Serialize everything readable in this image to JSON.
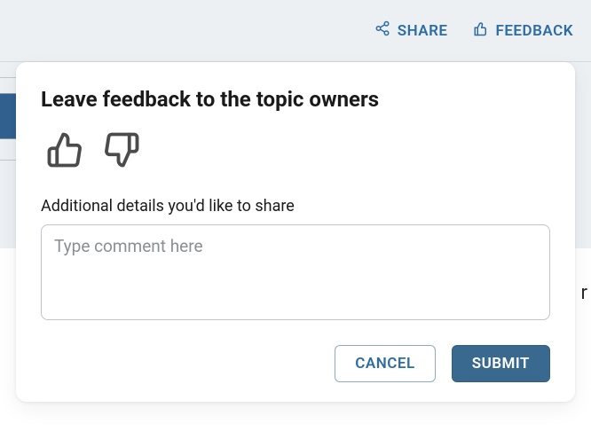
{
  "topbar": {
    "share_label": "SHARE",
    "feedback_label": "FEEDBACK"
  },
  "modal": {
    "title": "Leave feedback to the topic owners",
    "details_label": "Additional details you'd like to share",
    "comment_placeholder": "Type comment here",
    "cancel_label": "CANCEL",
    "submit_label": "SUBMIT"
  }
}
